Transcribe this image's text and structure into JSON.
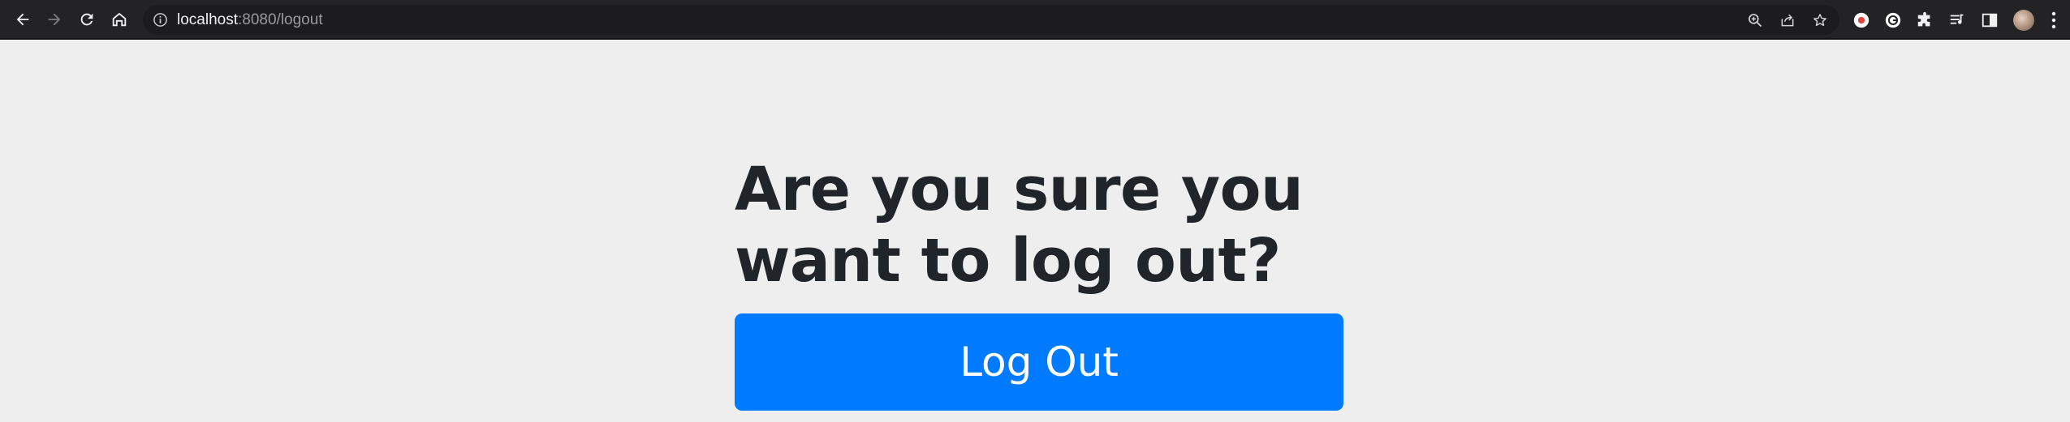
{
  "browser": {
    "url_host": "localhost",
    "url_rest": ":8080/logout",
    "back_icon": "arrow-left-icon",
    "forward_icon": "arrow-right-icon",
    "reload_icon": "reload-icon",
    "home_icon": "home-icon",
    "site_info_icon": "info-icon",
    "zoom_icon": "zoom-icon",
    "share_icon": "share-icon",
    "bookmark_icon": "star-icon",
    "extensions": [
      "record-extension-icon",
      "grammarly-extension-icon",
      "puzzle-icon",
      "media-list-icon",
      "side-panel-icon"
    ],
    "profile_icon": "avatar",
    "menu_icon": "kebab-menu-icon"
  },
  "page": {
    "heading": "Are you sure you want to log out?",
    "logout_button": "Log Out",
    "accent": "#007bff",
    "background": "#eeeeee",
    "text_color": "#212529"
  }
}
